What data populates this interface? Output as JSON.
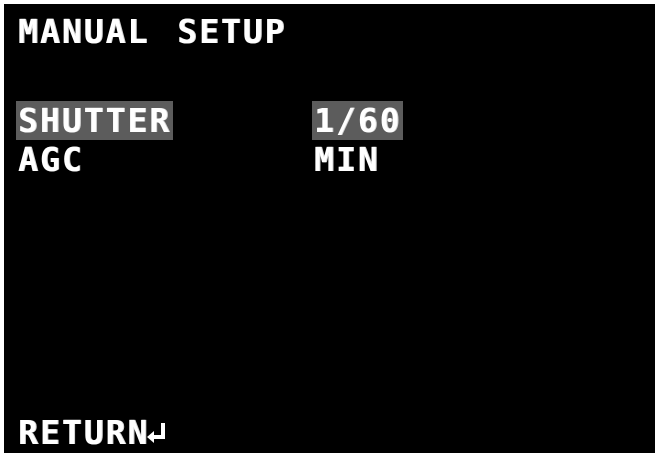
{
  "menu": {
    "title": "MANUAL SETUP",
    "items": [
      {
        "label": "SHUTTER",
        "value": "1/60",
        "selected": true
      },
      {
        "label": "AGC",
        "value": "MIN",
        "selected": false
      }
    ],
    "return_label": "RETURN",
    "return_icon": "enter-return-icon"
  },
  "colors": {
    "background": "#000000",
    "text": "#ffffff",
    "highlight": "#5c5c5c"
  }
}
